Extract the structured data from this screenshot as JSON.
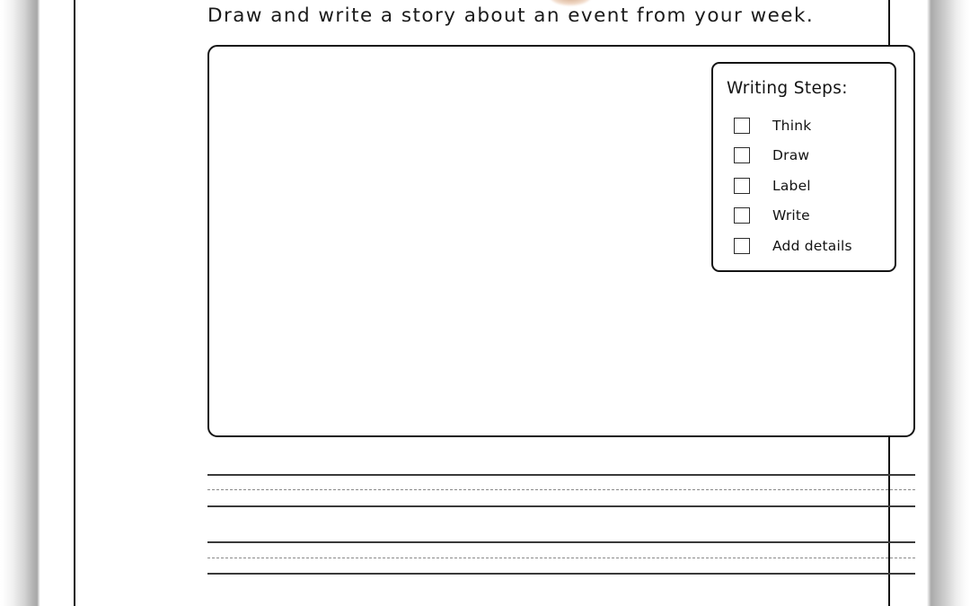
{
  "page": {
    "type": "handwriting-worksheet",
    "paper_color": "#ffffff",
    "ink_color": "#141414"
  },
  "prompt": {
    "text": "Draw and write a story about an event from your week."
  },
  "drawing_area": {
    "label": "drawing-box",
    "content": ""
  },
  "writing_steps": {
    "title": "Writing Steps:",
    "items": [
      {
        "label": "Think",
        "checked": false
      },
      {
        "label": "Draw",
        "checked": false
      },
      {
        "label": "Label",
        "checked": false
      },
      {
        "label": "Write",
        "checked": false
      },
      {
        "label": "Add details",
        "checked": false
      }
    ]
  },
  "writing_lines": {
    "groups": [
      {
        "name": "line-group-1",
        "rules": [
          "solid",
          "dashed",
          "solid"
        ]
      },
      {
        "name": "line-group-2",
        "rules": [
          "solid",
          "dashed",
          "solid"
        ]
      }
    ]
  },
  "decoration": {
    "top_graphic": "cropped-illustration"
  }
}
